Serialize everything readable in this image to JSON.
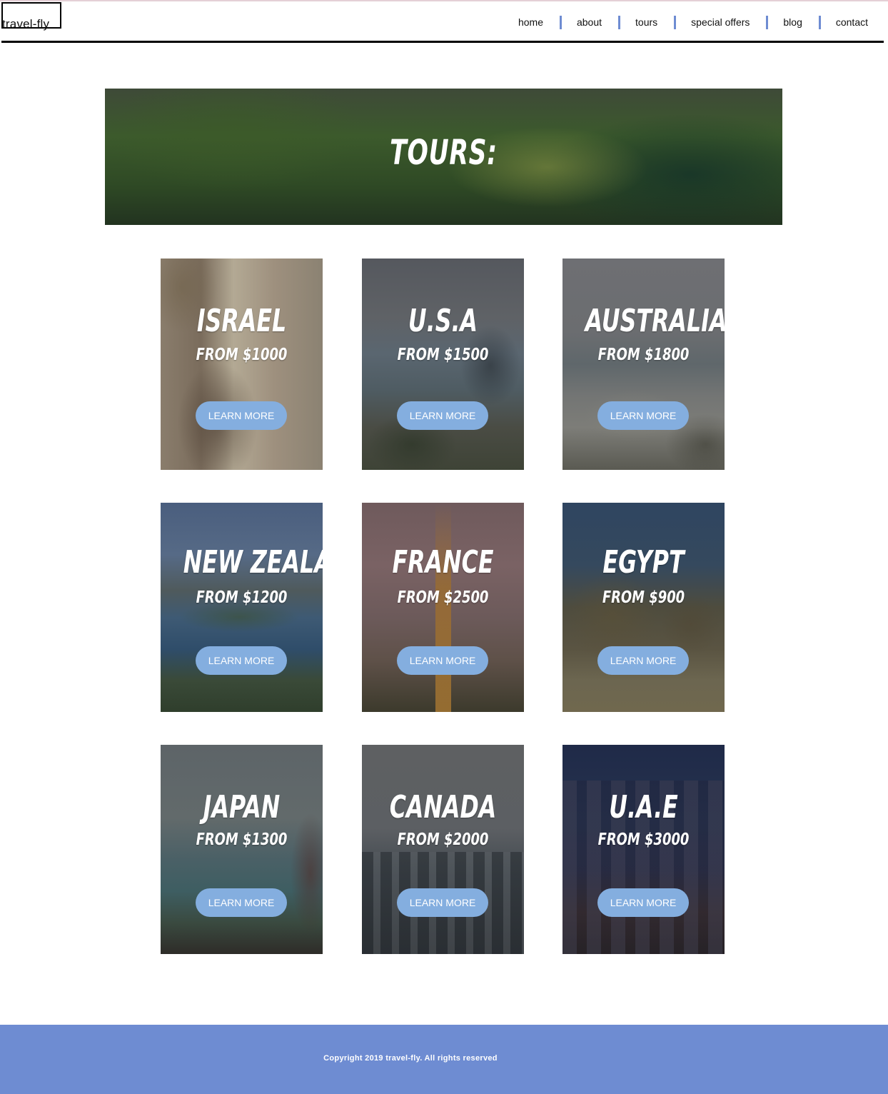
{
  "header": {
    "logo": "travel-fly",
    "nav": [
      {
        "label": "home"
      },
      {
        "label": "about"
      },
      {
        "label": "tours"
      },
      {
        "label": "special offers"
      },
      {
        "label": "blog"
      },
      {
        "label": "contact"
      }
    ],
    "accent_color": "#6e8cd2"
  },
  "hero": {
    "title": "TOURS:"
  },
  "tours": [
    {
      "name": "ISRAEL",
      "price": "FROM $1000",
      "button": "LEARN MORE"
    },
    {
      "name": "U.S.A",
      "price": "FROM $1500",
      "button": "LEARN MORE"
    },
    {
      "name": "AUSTRALIA",
      "price": "FROM $1800",
      "button": "LEARN MORE"
    },
    {
      "name": "NEW ZEALAND",
      "price": "FROM $1200",
      "button": "LEARN MORE"
    },
    {
      "name": "FRANCE",
      "price": "FROM $2500",
      "button": "LEARN MORE"
    },
    {
      "name": "EGYPT",
      "price": "FROM $900",
      "button": "LEARN MORE"
    },
    {
      "name": "JAPAN",
      "price": "FROM $1300",
      "button": "LEARN MORE"
    },
    {
      "name": "CANADA",
      "price": "FROM $2000",
      "button": "LEARN MORE"
    },
    {
      "name": "U.A.E",
      "price": "FROM $3000",
      "button": "LEARN MORE"
    }
  ],
  "button_color": "#84aedf",
  "footer": {
    "copyright": "Copyright 2019 travel-fly. All rights reserved"
  }
}
